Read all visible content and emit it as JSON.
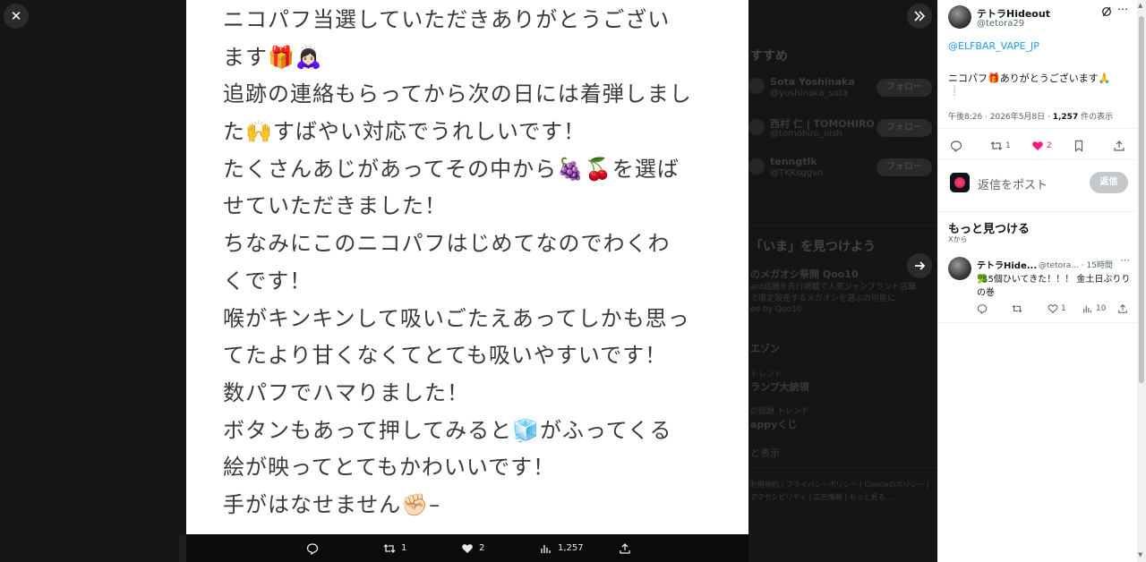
{
  "image": {
    "lines": [
      "ニコパフ当選していただきありがとうござい",
      "ます🎁🙇🏻‍♀️",
      "追跡の連絡もらってから次の日には着弾しまし",
      "た🙌すばやい対応でうれしいです！",
      "たくさんあじがあってその中から🍇🍒を選ば",
      "せていただきました！",
      "ちなみにこのニコパフはじめてなのでわくわ",
      "くです！",
      "喉がキンキンして吸いごたえあってしかも思っ",
      "てたより甘くなくてとても吸いやすいです！",
      "数パフでハマりました！",
      "ボタンもあって押してみると🧊がふってくる",
      "絵が映ってとてもかわいいです！",
      "手がはなせません✊🏻‍–"
    ]
  },
  "media_actions": {
    "retweets": "1",
    "likes": "2",
    "views": "1,257"
  },
  "backdrop": {
    "recommend_heading": "すすめ",
    "users": [
      {
        "name": "Sota Yoshinaka",
        "handle": "@yoshinaka_sota",
        "follow": "フォロー"
      },
      {
        "name": "西村 仁 | TOMOHIRO",
        "handle": "@tomohiro_nish",
        "follow": "フォロー"
      },
      {
        "name": "tenngtlk",
        "handle": "@TKKsggvn",
        "follow": "フォロー"
      }
    ],
    "trends_heading": "「いま」を見つけよう",
    "trends": [
      {
        "title": "のメガオシ祭開 Qoo10",
        "desc": "ant話題を先行掲載で人気ジャンブランド店舗",
        "desc2": "で限定販売するメガオシを選ぶの可能に",
        "meta": "ed by Qoo10"
      },
      {
        "title": "エゾン",
        "desc": "",
        "desc2": "",
        "meta": ""
      },
      {
        "title": "ランプ大統領",
        "desc": "トレンド",
        "desc2": "",
        "meta": ""
      },
      {
        "title": "appyくじ",
        "desc": "の話題 トレンド",
        "desc2": "",
        "meta": ""
      }
    ],
    "more_link": "と表示",
    "footer": "利用規約 | プライバシーポリシー | Cookieのポリシー | アクセシビリティ | 広告情報 | もっと見る ..."
  },
  "sidebar": {
    "author_name": "テトラHideout",
    "author_handle": "@tetora29",
    "mention": "@ELFBAR_VAPE_JP",
    "tweet_text": "ニコパフ🎁ありがとうございます🙏",
    "tweet_text2": "❕",
    "timestamp": "午後8:26 · 2026年5月8日 · ",
    "views_count": "1,257",
    "views_suffix": " 件の表示",
    "retweets": "1",
    "likes": "2",
    "reply_placeholder": "返信をポスト",
    "reply_button": "返信",
    "discover_title": "もっと見つける",
    "discover_sub": "Xから",
    "rec_name": "テトラHide...",
    "rec_handle": "@tetora... · 15時間",
    "rec_text1": "🥦5個ひいてきた！！！ 金土日ぶりり",
    "rec_text2": "の巻",
    "rec_likes": "1",
    "rec_views": "10"
  }
}
